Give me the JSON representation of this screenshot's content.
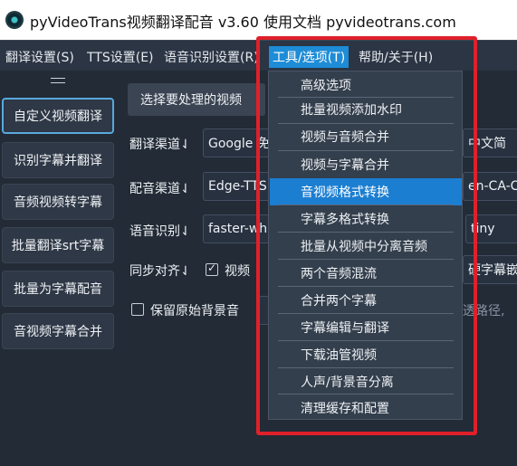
{
  "window": {
    "title": "pyVideoTrans视频翻译配音 v3.60  使用文档  pyvideotrans.com"
  },
  "menubar": {
    "items": [
      "翻译设置(S)",
      "TTS设置(E)",
      "语音识别设置(R)",
      "工具/选项(T)",
      "帮助/关于(H)"
    ]
  },
  "sidebar": {
    "items": [
      "自定义视频翻译",
      "识别字幕并翻译",
      "音频视频转字幕",
      "批量翻译srt字幕",
      "批量为字幕配音",
      "音视频字幕合并"
    ]
  },
  "main": {
    "choose_button": "选择要处理的视频",
    "translate_label": "翻译渠道⇃",
    "translate_value": "Google 免",
    "target_lang_value": "中文简",
    "dub_label": "配音渠道⇃",
    "dub_value": "Edge-TTS",
    "voice_value": "en-CA-C",
    "asr_label": "语音识别⇃",
    "asr_value": "faster-wh",
    "model_value": "tiny",
    "sync_label": "同步对齐⇃",
    "video_check_label": "视频",
    "hard_sub_label": "硬字幕嵌",
    "keep_bg_label": "保留原始背景音",
    "path_placeholder": "透路径,"
  },
  "tools_menu": {
    "items": [
      "高级选项",
      "批量视频添加水印",
      "视频与音频合并",
      "视频与字幕合并",
      "音视频格式转换",
      "字幕多格式转换",
      "批量从视频中分离音频",
      "两个音频混流",
      "合并两个字幕",
      "字幕编辑与翻译",
      "下载油管视频",
      "人声/背景音分离",
      "清理缓存和配置"
    ],
    "highlighted": "音视频格式转换"
  },
  "colors": {
    "highlight": "#1c7ed1",
    "annotation_frame": "#e0202a",
    "menubar": "#2b3544"
  }
}
